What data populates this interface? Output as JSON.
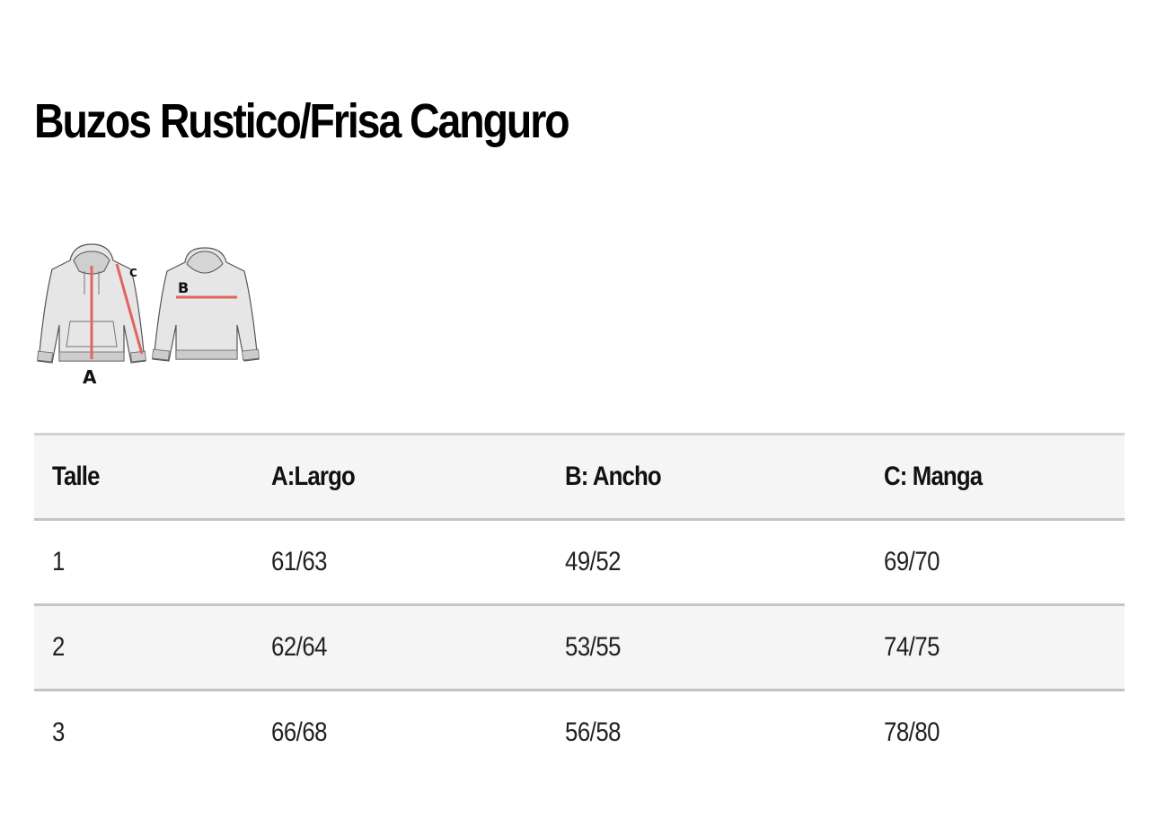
{
  "title": "Buzos Rustico/Frisa Canguro",
  "diagram": {
    "labels": {
      "a": "A",
      "b": "B",
      "c": "C"
    },
    "colors": {
      "garment_fill": "#e6e6e6",
      "garment_stroke": "#555555",
      "measure_line": "#e0645f"
    }
  },
  "table": {
    "headers": [
      "Talle",
      "A:Largo",
      "B: Ancho",
      "C: Manga"
    ],
    "rows": [
      [
        "1",
        "61/63",
        "49/52",
        "69/70"
      ],
      [
        "2",
        "62/64",
        "53/55",
        "74/75"
      ],
      [
        "3",
        "66/68",
        "56/58",
        "78/80"
      ]
    ]
  },
  "colors": {
    "header_bg": "#f5f5f5",
    "row_alt_bg": "#f5f5f5",
    "border": "#c4c4c4"
  }
}
